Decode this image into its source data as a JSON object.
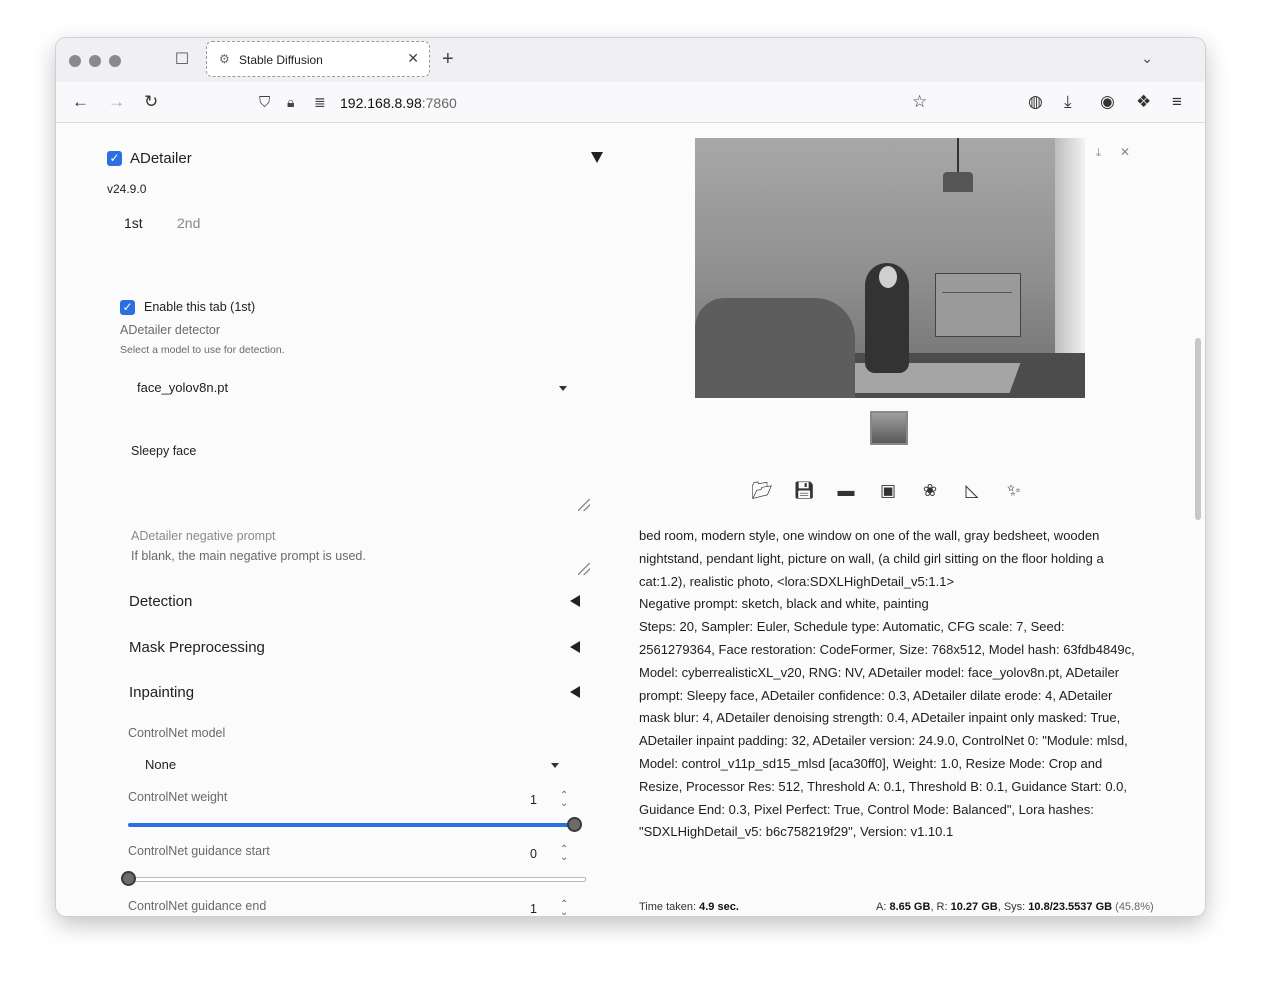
{
  "browser": {
    "tab_title": "Stable Diffusion",
    "url_host": "192.168.8.98",
    "url_port": ":7860"
  },
  "left": {
    "section_title": "ADetailer",
    "version": "v24.9.0",
    "tabs": [
      {
        "label": "1st",
        "active": true
      },
      {
        "label": "2nd",
        "active": false
      }
    ],
    "enable_tab_label": "Enable this tab (1st)",
    "detector_label": "ADetailer detector",
    "detector_desc": "Select a model to use for detection.",
    "detector_value": "face_yolov8n.pt",
    "prompt_value": "Sleepy face",
    "neg_prompt_placeholder": "ADetailer negative prompt",
    "neg_prompt_hint": "If blank, the main negative prompt is used.",
    "accordions": [
      "Detection",
      "Mask Preprocessing",
      "Inpainting"
    ],
    "controlnet_model_label": "ControlNet model",
    "controlnet_model_value": "None",
    "sliders": [
      {
        "label": "ControlNet weight",
        "value": "1",
        "min": 0,
        "max": 1,
        "fraction": 1.0
      },
      {
        "label": "ControlNet guidance start",
        "value": "0",
        "min": 0,
        "max": 1,
        "fraction": 0.0
      },
      {
        "label": "ControlNet guidance end",
        "value": "1",
        "min": 0,
        "max": 1,
        "fraction": 1.0
      }
    ]
  },
  "right": {
    "tool_icons": [
      "folder-icon",
      "save-icon",
      "zip-icon",
      "image-icon",
      "palette-icon",
      "ruler-icon",
      "sparkle-icon"
    ],
    "gen_info": [
      "bed room, modern style, one window on one of the wall, gray bedsheet, wooden nightstand, pendant light, picture on wall, (a child girl sitting on the floor holding a cat:1.2), realistic photo, <lora:SDXLHighDetail_v5:1.1>",
      "Negative prompt: sketch, black and white, painting",
      "Steps: 20, Sampler: Euler, Schedule type: Automatic, CFG scale: 7, Seed: 2561279364, Face restoration: CodeFormer, Size: 768x512, Model hash: 63fdb4849c, Model: cyberrealisticXL_v20, RNG: NV, ADetailer model: face_yolov8n.pt, ADetailer prompt: Sleepy face, ADetailer confidence: 0.3, ADetailer dilate erode: 4, ADetailer mask blur: 4, ADetailer denoising strength: 0.4, ADetailer inpaint only masked: True, ADetailer inpaint padding: 32, ADetailer version: 24.9.0, ControlNet 0: \"Module: mlsd, Model: control_v11p_sd15_mlsd [aca30ff0], Weight: 1.0, Resize Mode: Crop and Resize, Processor Res: 512, Threshold A: 0.1, Threshold B: 0.1, Guidance Start: 0.0, Guidance End: 0.3, Pixel Perfect: True, Control Mode: Balanced\", Lora hashes: \"SDXLHighDetail_v5: b6c758219f29\", Version: v1.10.1"
    ],
    "time_label": "Time taken:",
    "time_value": "4.9 sec.",
    "mem_a_label": "A:",
    "mem_a_value": "8.65 GB",
    "mem_r_label": ", R:",
    "mem_r_value": "10.27 GB",
    "mem_sys_label": ", Sys:",
    "mem_sys_value": "10.8/23.5537 GB",
    "mem_pct": "(45.8%)"
  },
  "colors": {
    "accent": "#2b6fe0",
    "slider_fill": "#2b6fe0",
    "slider_empty": "#e2e2e2"
  }
}
